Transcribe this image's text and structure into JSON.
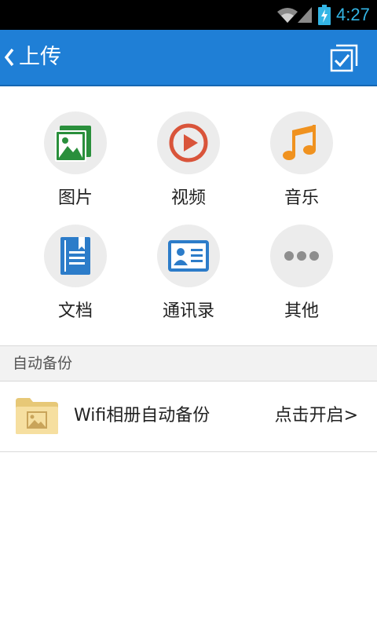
{
  "status_bar": {
    "time": "4:27",
    "icons": [
      "wifi-icon",
      "signal-icon",
      "battery-charging-icon"
    ],
    "time_color": "#33b5e5"
  },
  "header": {
    "title": "上传",
    "back_icon": "chevron-left-icon",
    "action_icon": "multi-select-icon",
    "background": "#1f7fd6"
  },
  "categories": [
    {
      "label": "图片",
      "icon": "image-icon",
      "color": "#2a8f3c"
    },
    {
      "label": "视频",
      "icon": "play-icon",
      "color": "#d9543a"
    },
    {
      "label": "音乐",
      "icon": "music-note-icon",
      "color": "#f0921f"
    },
    {
      "label": "文档",
      "icon": "document-icon",
      "color": "#2c7cc9"
    },
    {
      "label": "通讯录",
      "icon": "contact-card-icon",
      "color": "#2c7cc9"
    },
    {
      "label": "其他",
      "icon": "more-icon",
      "color": "#8e8e8e"
    }
  ],
  "auto_backup": {
    "section_title": "自动备份",
    "row_title": "Wifi相册自动备份",
    "row_action": "点击开启>",
    "row_icon": "photo-folder-icon"
  }
}
